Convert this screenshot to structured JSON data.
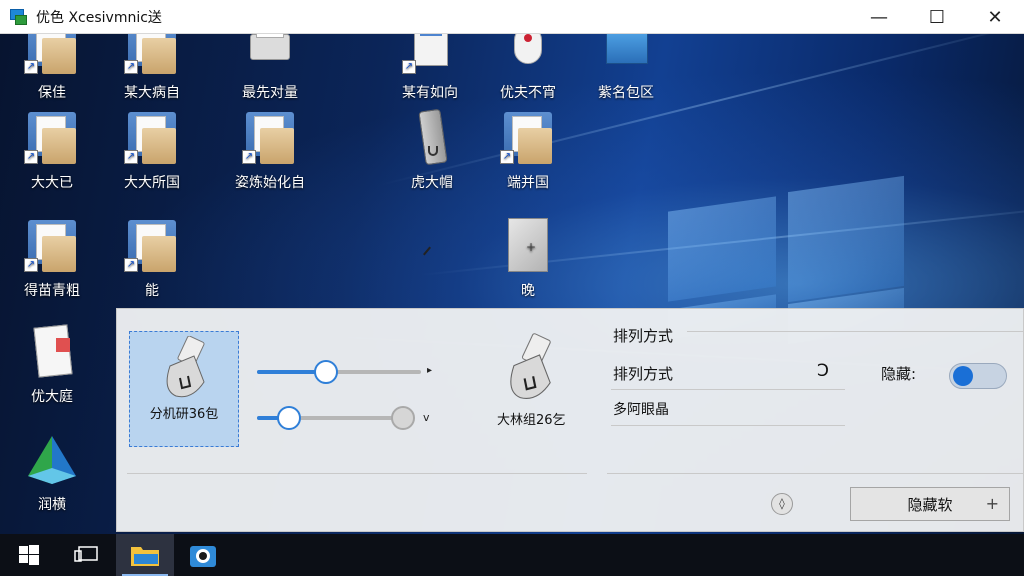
{
  "window": {
    "title": "优色 Xcesivmnic送",
    "controls": [
      "—",
      "☐",
      "✕"
    ]
  },
  "desktop_icons": [
    {
      "label": "保佳",
      "icon": "folder-shortcut-icon"
    },
    {
      "label": "某大病自",
      "icon": "folder-shortcut-icon"
    },
    {
      "label": "最先对量",
      "icon": "printer-icon"
    },
    {
      "label": "某有如向",
      "icon": "document-shortcut-icon"
    },
    {
      "label": "优夫不宵",
      "icon": "mouse-icon"
    },
    {
      "label": "紫名包区",
      "icon": "blue-box-icon"
    },
    {
      "label": "大大已",
      "icon": "folder-shortcut-icon"
    },
    {
      "label": "大大所国",
      "icon": "folder-shortcut-icon"
    },
    {
      "label": "姿炼始化自",
      "icon": "folder-shortcut-icon"
    },
    {
      "label": "虎大帽",
      "icon": "remote-icon"
    },
    {
      "label": "端并国",
      "icon": "folder-shortcut-icon"
    },
    {
      "label": "得苗青粗",
      "icon": "folder-shortcut-icon"
    },
    {
      "label": "能",
      "icon": "folder-shortcut-icon"
    },
    {
      "label": "晚",
      "icon": "grey-tile-icon"
    },
    {
      "label": "优大庭",
      "icon": "document-icon"
    },
    {
      "label": "润横",
      "icon": "pyramid-app-icon"
    }
  ],
  "panel": {
    "selected_device_label": "分机研36包",
    "second_device_label": "大林组26乞",
    "slider1_value": 0.42,
    "slider2_value": 0.22,
    "slider_arrow1": "▸",
    "slider_arrow2": "v",
    "heading": "排列方式",
    "sort_label": "排列方式",
    "sort_icon": "Ↄ",
    "hide_label": "隐藏:",
    "toggle_on": true,
    "sub_text": "多阿眼晶",
    "info_icon": "◊",
    "action_button": "隐藏软",
    "action_plus": "+"
  },
  "taskbar": {
    "items": [
      "start-icon",
      "task-view-icon",
      "file-explorer-icon",
      "store-icon"
    ]
  }
}
